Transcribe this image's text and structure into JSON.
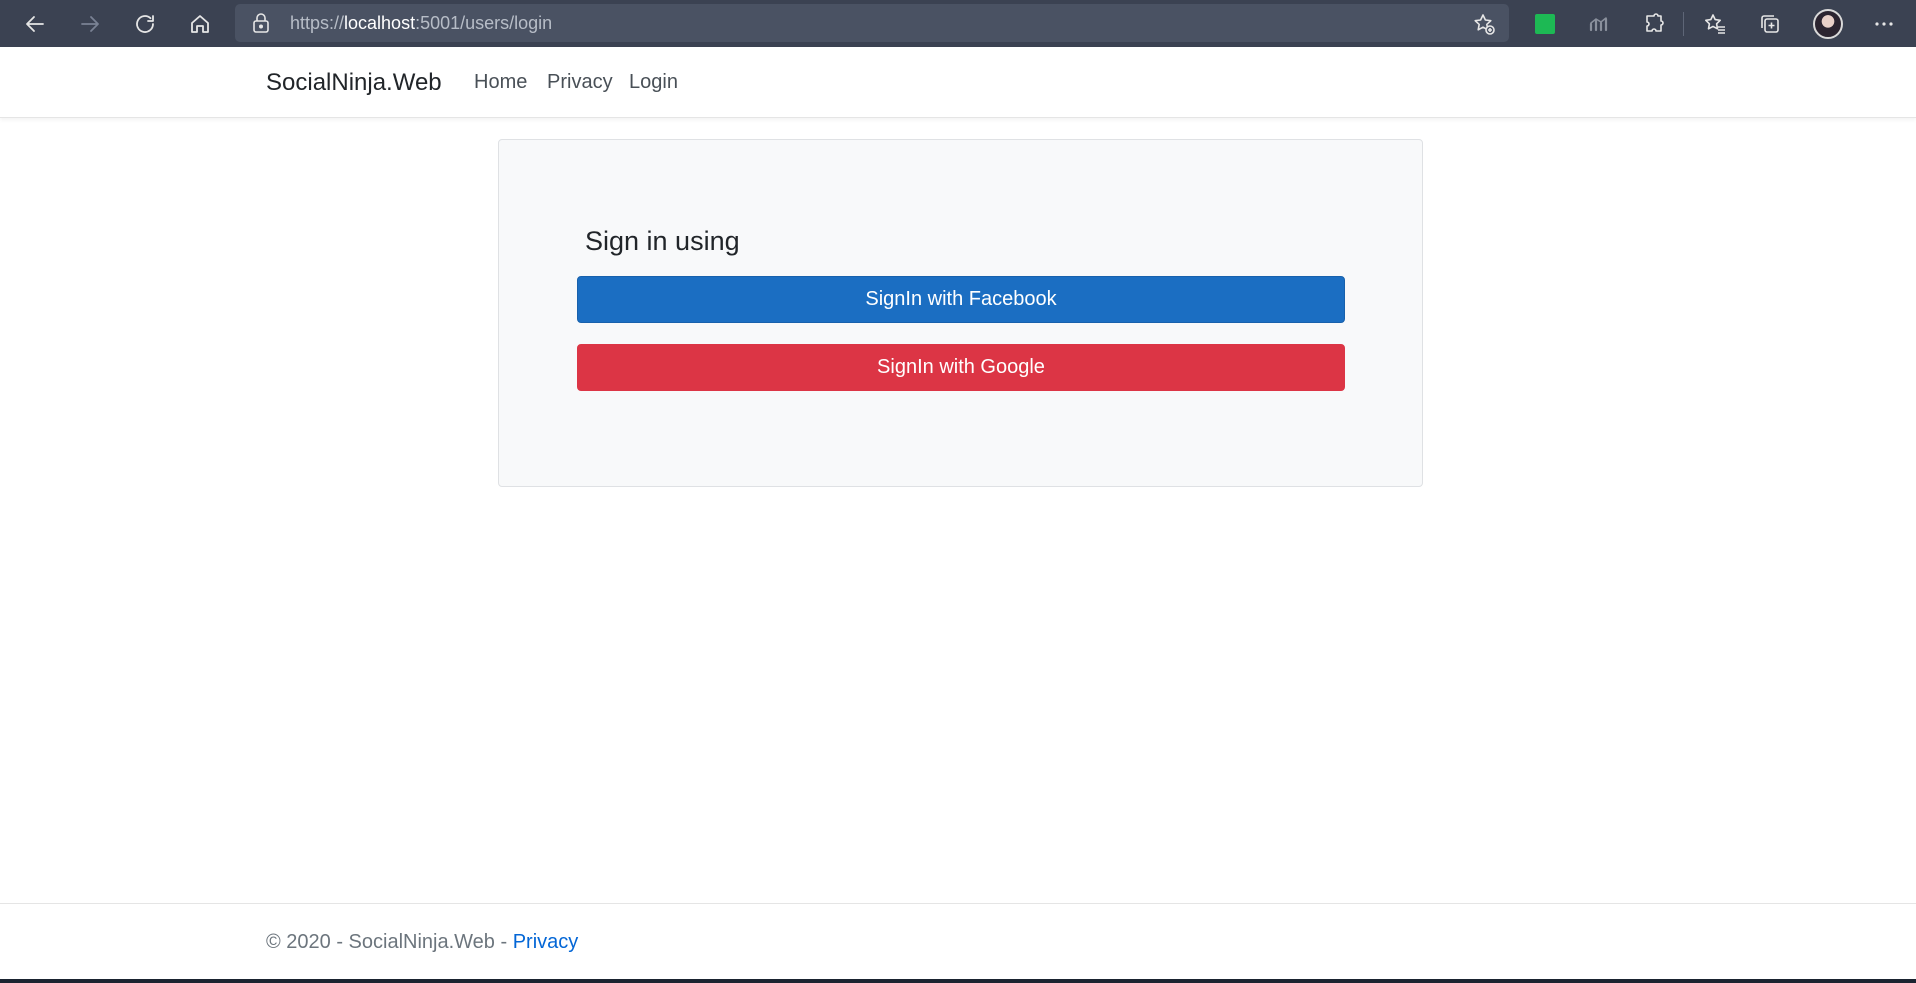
{
  "browser": {
    "url_scheme": "https://",
    "url_host": "localhost",
    "url_rest": ":5001/users/login"
  },
  "site": {
    "brand": "SocialNinja.Web",
    "nav": {
      "home": "Home",
      "privacy": "Privacy",
      "login": "Login"
    }
  },
  "login_card": {
    "title": "Sign in using",
    "facebook_button": "SignIn with Facebook",
    "google_button": "SignIn with Google"
  },
  "footer": {
    "copyright": "© 2020 - SocialNinja.Web - ",
    "privacy_link": "Privacy"
  },
  "colors": {
    "browser_chrome": "#3b4252",
    "facebook_blue": "#1b6ec2",
    "google_red": "#dc3545",
    "link_blue": "#0366d6",
    "card_bg": "#f8f9fa"
  },
  "icons": {
    "back": "back-arrow-icon",
    "forward": "forward-arrow-icon",
    "refresh": "refresh-icon",
    "home": "home-icon",
    "lock": "lock-icon",
    "favorite": "add-favorite-icon",
    "extension_green": "green-extension-icon",
    "extension_chart": "chart-extension-icon",
    "extensions": "puzzle-icon",
    "favorites": "favorites-icon",
    "collections": "collections-icon",
    "profile": "profile-avatar",
    "menu": "more-icon"
  }
}
